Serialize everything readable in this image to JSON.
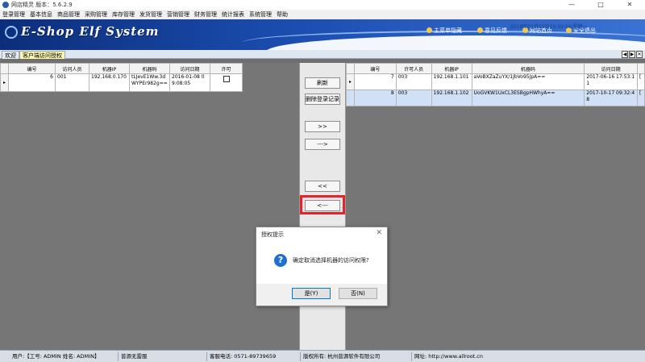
{
  "window": {
    "title": "网店精灵  版本：5.6.2.9",
    "minimize_glyph": "—",
    "maximize_glyph": "□",
    "close_glyph": "✕"
  },
  "menu": [
    "登录管理",
    "基本信息",
    "商品管理",
    "采购管理",
    "库存管理",
    "发货管理",
    "营销管理",
    "财务管理",
    "统计报表",
    "系统管理",
    "帮助"
  ],
  "banner": {
    "brand": "E-Shop Elf System",
    "links": [
      "主菜单隐藏",
      "意见反馈",
      "网站首页",
      "安全退出"
    ],
    "datetime": "2018年01月15日19:59:56/星期一"
  },
  "tabs": [
    "欢迎",
    "客户端访问授权"
  ],
  "tab_controls": [
    "◀",
    "▶",
    "✕"
  ],
  "left_table": {
    "columns": [
      "编号",
      "访问人员",
      "机器IP",
      "机器码",
      "访问日期",
      "许可"
    ],
    "rows": [
      {
        "pointer": "▸",
        "id": "6",
        "user": "001",
        "ip": "192.168.0.170",
        "code": "tLJevE1Ww.3dWYPEr982g==",
        "date": "2016-01-08 09:08:05",
        "checked": false
      }
    ]
  },
  "right_table": {
    "columns": [
      "编号",
      "许可人员",
      "机器IP",
      "机器码",
      "访问日期"
    ],
    "rows": [
      {
        "pointer": "▸",
        "id": "7",
        "user": "003",
        "ip": "192.168.1.101",
        "code": "aVoBXZaZuYX/1JbVo95JpA==",
        "date": "2017-06-16 17:53:11",
        "extra": "[",
        "selected": false
      },
      {
        "pointer": "",
        "id": "8",
        "user": "003",
        "ip": "192.168.1.102",
        "code": "UoGVKW1UxCL3ESBgpHWhyA==",
        "date": "2017-10-17 09:32:48",
        "extra": "[",
        "selected": true
      }
    ]
  },
  "middle_buttons": {
    "refresh": "刷新",
    "delete_login": "删除登录记录",
    "move_all_right": ">>",
    "move_right": "--->",
    "move_all_left": "<<",
    "move_left": "<---"
  },
  "dialog": {
    "title": "授权提示",
    "close_glyph": "✕",
    "icon_glyph": "?",
    "message": "确定取消选择机器的访问权限?",
    "yes": "是(Y)",
    "no": "否(N)"
  },
  "statusbar": {
    "user": "用户:【工号: ADMIN  姓名: ADMIN】",
    "company_short": "普源无雷服",
    "phone": "客服电话: 0571-89739659",
    "copyright": "版权所有: 杭州普源软件有限公司",
    "website": "网址: http://www.allroot.cn"
  },
  "colors": {
    "banner_dark": "#0c2e7a",
    "banner_light": "#3a73d4",
    "highlight_box": "#e8212a",
    "selected_row": "#cfe0f7",
    "active_tab": "#fff7b0"
  }
}
